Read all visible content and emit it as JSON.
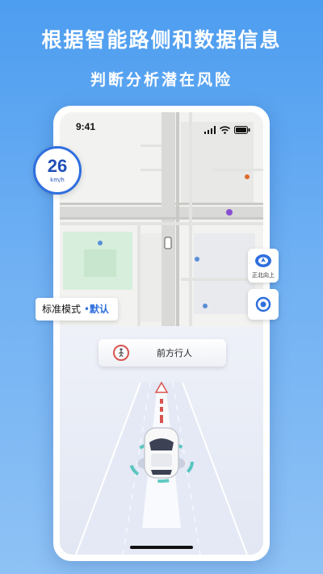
{
  "headline": "根据智能路侧和数据信息",
  "subheadline": "判断分析潜在风险",
  "status_bar": {
    "time": "9:41"
  },
  "speed": {
    "value": "26",
    "unit": "km/h"
  },
  "mode": {
    "label": "标准模式",
    "dot": "•",
    "value": "默认"
  },
  "map_controls": {
    "north_up_label": "正北向上"
  },
  "alert": {
    "label": "前方行人"
  },
  "colors": {
    "accent": "#2f6fde",
    "background": "#5ea7f2"
  }
}
